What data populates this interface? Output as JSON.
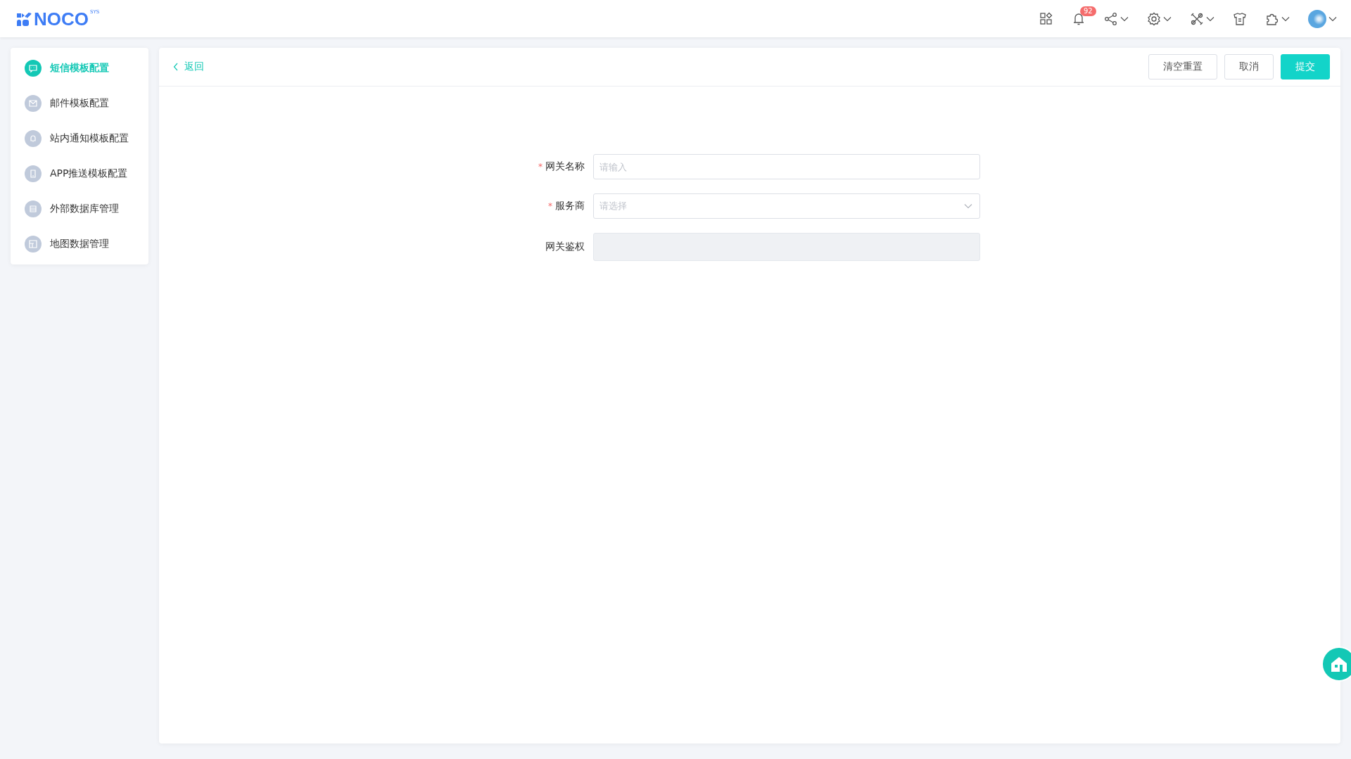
{
  "header": {
    "logo": "NOCO",
    "logo_sup": "SYS",
    "notification_badge": "92"
  },
  "sidebar": {
    "items": [
      {
        "label": "短信模板配置",
        "selected": true
      },
      {
        "label": "邮件模板配置",
        "selected": false
      },
      {
        "label": "站内通知模板配置",
        "selected": false
      },
      {
        "label": "APP推送模板配置",
        "selected": false
      },
      {
        "label": "外部数据库管理",
        "selected": false
      },
      {
        "label": "地图数据管理",
        "selected": false
      }
    ]
  },
  "toolbar": {
    "back_link": "返回",
    "buttons": [
      {
        "label": "清空重置",
        "kind": "default"
      },
      {
        "label": "取消",
        "kind": "default"
      },
      {
        "label": "提交",
        "kind": "primary"
      }
    ]
  },
  "form": {
    "fields": [
      {
        "label": "网关名称",
        "required_mark": "*",
        "kind": "input",
        "placeholder": "请输入",
        "disabled": false
      },
      {
        "label": "服务商",
        "required_mark": "*",
        "kind": "select",
        "placeholder": "请选择",
        "disabled": false
      },
      {
        "label": "网关鉴权",
        "kind": "textarea",
        "disabled": true
      }
    ]
  }
}
